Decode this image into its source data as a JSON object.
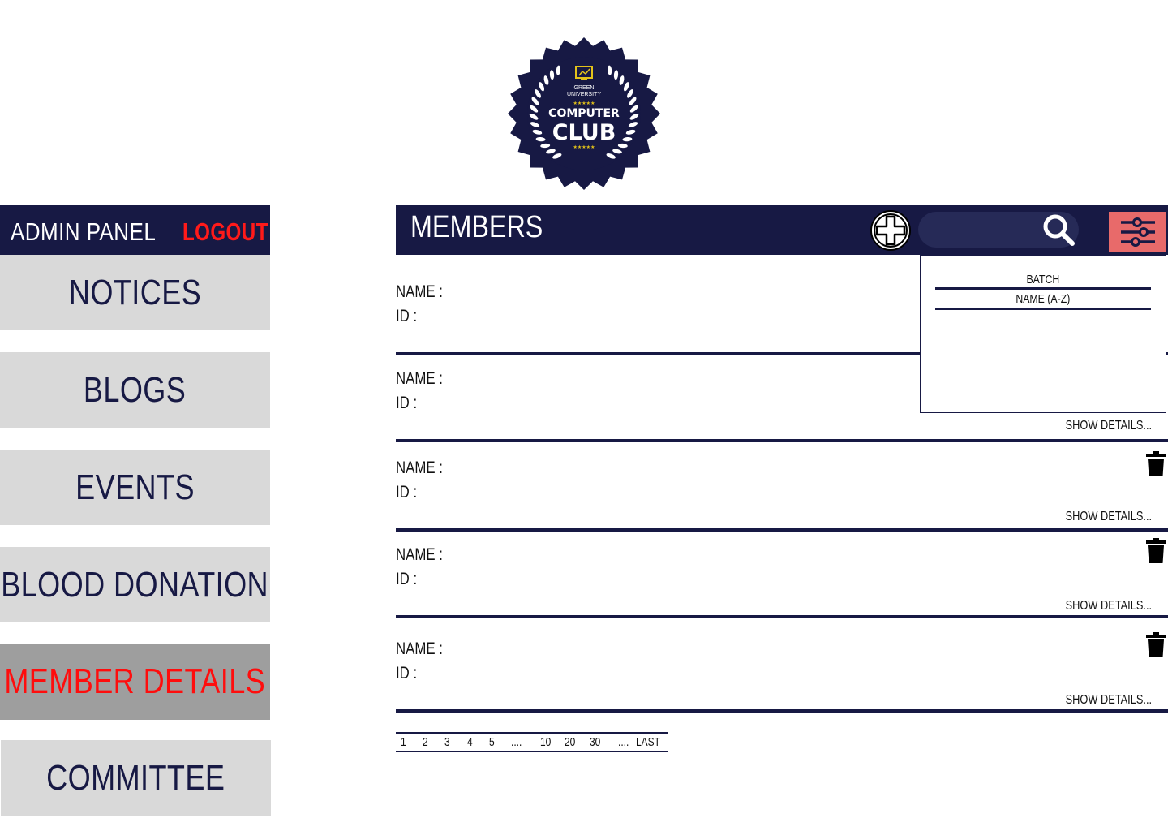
{
  "logo": {
    "line1": "GREEN",
    "line2": "UNIVERSITY",
    "line3": "COMPUTER",
    "line4": "CLUB"
  },
  "sidebar": {
    "title": "ADMIN PANEL",
    "logout_label": "LOGOUT",
    "items": [
      {
        "label": "NOTICES"
      },
      {
        "label": "BLOGS"
      },
      {
        "label": "EVENTS"
      },
      {
        "label": "BLOOD DONATION"
      },
      {
        "label": "MEMBER DETAILS"
      },
      {
        "label": "COMMITTEE"
      }
    ],
    "active_item": "MEMBER DETAILS"
  },
  "header": {
    "title": "MEMBERS",
    "add_icon": "plus-circle-icon",
    "search_placeholder": "",
    "search_icon": "search-icon",
    "filter_icon": "sliders-icon"
  },
  "members": {
    "name_label": "NAME :",
    "id_label": "ID :",
    "show_details_label": "SHOW DETAILS...",
    "delete_icon": "trash-icon"
  },
  "sort_menu": {
    "options": [
      "BATCH",
      "NAME (A-Z)"
    ]
  },
  "pagination": {
    "pages": [
      "1",
      "2",
      "3",
      "4",
      "5",
      "....",
      "10",
      "20",
      "30",
      "....",
      "LAST"
    ]
  },
  "colors": {
    "navy": "#171944",
    "nav_bg": "#d9d9d9",
    "nav_active_bg": "#9e9e9e",
    "active_text": "#ff0d0d",
    "logout": "#ff1a1a",
    "filter_btn": "#e86a6a",
    "search_bg": "#262a57"
  }
}
